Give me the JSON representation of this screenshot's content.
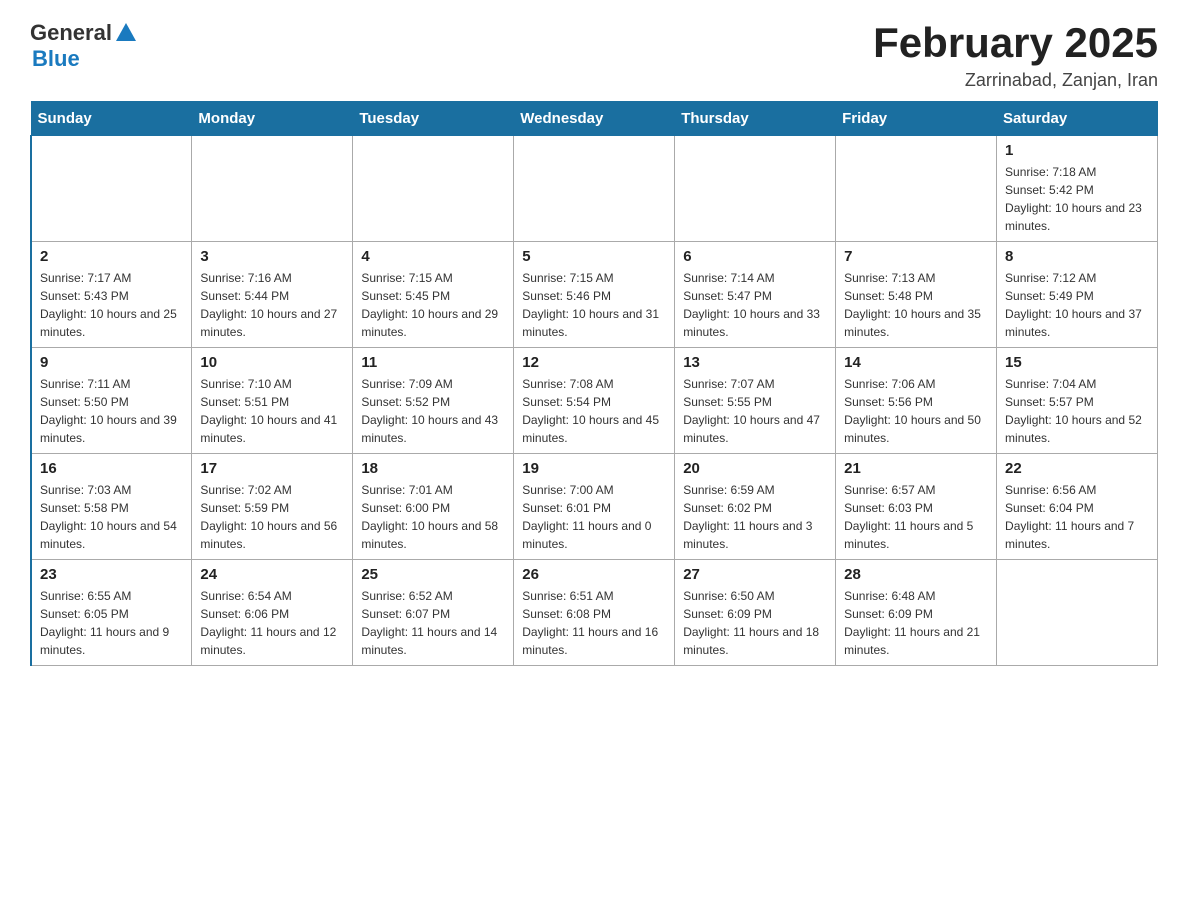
{
  "header": {
    "logo_general": "General",
    "logo_blue": "Blue",
    "month_title": "February 2025",
    "subtitle": "Zarrinabad, Zanjan, Iran"
  },
  "weekdays": [
    "Sunday",
    "Monday",
    "Tuesday",
    "Wednesday",
    "Thursday",
    "Friday",
    "Saturday"
  ],
  "weeks": [
    [
      {
        "day": "",
        "sunrise": "",
        "sunset": "",
        "daylight": ""
      },
      {
        "day": "",
        "sunrise": "",
        "sunset": "",
        "daylight": ""
      },
      {
        "day": "",
        "sunrise": "",
        "sunset": "",
        "daylight": ""
      },
      {
        "day": "",
        "sunrise": "",
        "sunset": "",
        "daylight": ""
      },
      {
        "day": "",
        "sunrise": "",
        "sunset": "",
        "daylight": ""
      },
      {
        "day": "",
        "sunrise": "",
        "sunset": "",
        "daylight": ""
      },
      {
        "day": "1",
        "sunrise": "Sunrise: 7:18 AM",
        "sunset": "Sunset: 5:42 PM",
        "daylight": "Daylight: 10 hours and 23 minutes."
      }
    ],
    [
      {
        "day": "2",
        "sunrise": "Sunrise: 7:17 AM",
        "sunset": "Sunset: 5:43 PM",
        "daylight": "Daylight: 10 hours and 25 minutes."
      },
      {
        "day": "3",
        "sunrise": "Sunrise: 7:16 AM",
        "sunset": "Sunset: 5:44 PM",
        "daylight": "Daylight: 10 hours and 27 minutes."
      },
      {
        "day": "4",
        "sunrise": "Sunrise: 7:15 AM",
        "sunset": "Sunset: 5:45 PM",
        "daylight": "Daylight: 10 hours and 29 minutes."
      },
      {
        "day": "5",
        "sunrise": "Sunrise: 7:15 AM",
        "sunset": "Sunset: 5:46 PM",
        "daylight": "Daylight: 10 hours and 31 minutes."
      },
      {
        "day": "6",
        "sunrise": "Sunrise: 7:14 AM",
        "sunset": "Sunset: 5:47 PM",
        "daylight": "Daylight: 10 hours and 33 minutes."
      },
      {
        "day": "7",
        "sunrise": "Sunrise: 7:13 AM",
        "sunset": "Sunset: 5:48 PM",
        "daylight": "Daylight: 10 hours and 35 minutes."
      },
      {
        "day": "8",
        "sunrise": "Sunrise: 7:12 AM",
        "sunset": "Sunset: 5:49 PM",
        "daylight": "Daylight: 10 hours and 37 minutes."
      }
    ],
    [
      {
        "day": "9",
        "sunrise": "Sunrise: 7:11 AM",
        "sunset": "Sunset: 5:50 PM",
        "daylight": "Daylight: 10 hours and 39 minutes."
      },
      {
        "day": "10",
        "sunrise": "Sunrise: 7:10 AM",
        "sunset": "Sunset: 5:51 PM",
        "daylight": "Daylight: 10 hours and 41 minutes."
      },
      {
        "day": "11",
        "sunrise": "Sunrise: 7:09 AM",
        "sunset": "Sunset: 5:52 PM",
        "daylight": "Daylight: 10 hours and 43 minutes."
      },
      {
        "day": "12",
        "sunrise": "Sunrise: 7:08 AM",
        "sunset": "Sunset: 5:54 PM",
        "daylight": "Daylight: 10 hours and 45 minutes."
      },
      {
        "day": "13",
        "sunrise": "Sunrise: 7:07 AM",
        "sunset": "Sunset: 5:55 PM",
        "daylight": "Daylight: 10 hours and 47 minutes."
      },
      {
        "day": "14",
        "sunrise": "Sunrise: 7:06 AM",
        "sunset": "Sunset: 5:56 PM",
        "daylight": "Daylight: 10 hours and 50 minutes."
      },
      {
        "day": "15",
        "sunrise": "Sunrise: 7:04 AM",
        "sunset": "Sunset: 5:57 PM",
        "daylight": "Daylight: 10 hours and 52 minutes."
      }
    ],
    [
      {
        "day": "16",
        "sunrise": "Sunrise: 7:03 AM",
        "sunset": "Sunset: 5:58 PM",
        "daylight": "Daylight: 10 hours and 54 minutes."
      },
      {
        "day": "17",
        "sunrise": "Sunrise: 7:02 AM",
        "sunset": "Sunset: 5:59 PM",
        "daylight": "Daylight: 10 hours and 56 minutes."
      },
      {
        "day": "18",
        "sunrise": "Sunrise: 7:01 AM",
        "sunset": "Sunset: 6:00 PM",
        "daylight": "Daylight: 10 hours and 58 minutes."
      },
      {
        "day": "19",
        "sunrise": "Sunrise: 7:00 AM",
        "sunset": "Sunset: 6:01 PM",
        "daylight": "Daylight: 11 hours and 0 minutes."
      },
      {
        "day": "20",
        "sunrise": "Sunrise: 6:59 AM",
        "sunset": "Sunset: 6:02 PM",
        "daylight": "Daylight: 11 hours and 3 minutes."
      },
      {
        "day": "21",
        "sunrise": "Sunrise: 6:57 AM",
        "sunset": "Sunset: 6:03 PM",
        "daylight": "Daylight: 11 hours and 5 minutes."
      },
      {
        "day": "22",
        "sunrise": "Sunrise: 6:56 AM",
        "sunset": "Sunset: 6:04 PM",
        "daylight": "Daylight: 11 hours and 7 minutes."
      }
    ],
    [
      {
        "day": "23",
        "sunrise": "Sunrise: 6:55 AM",
        "sunset": "Sunset: 6:05 PM",
        "daylight": "Daylight: 11 hours and 9 minutes."
      },
      {
        "day": "24",
        "sunrise": "Sunrise: 6:54 AM",
        "sunset": "Sunset: 6:06 PM",
        "daylight": "Daylight: 11 hours and 12 minutes."
      },
      {
        "day": "25",
        "sunrise": "Sunrise: 6:52 AM",
        "sunset": "Sunset: 6:07 PM",
        "daylight": "Daylight: 11 hours and 14 minutes."
      },
      {
        "day": "26",
        "sunrise": "Sunrise: 6:51 AM",
        "sunset": "Sunset: 6:08 PM",
        "daylight": "Daylight: 11 hours and 16 minutes."
      },
      {
        "day": "27",
        "sunrise": "Sunrise: 6:50 AM",
        "sunset": "Sunset: 6:09 PM",
        "daylight": "Daylight: 11 hours and 18 minutes."
      },
      {
        "day": "28",
        "sunrise": "Sunrise: 6:48 AM",
        "sunset": "Sunset: 6:09 PM",
        "daylight": "Daylight: 11 hours and 21 minutes."
      },
      {
        "day": "",
        "sunrise": "",
        "sunset": "",
        "daylight": ""
      }
    ]
  ]
}
